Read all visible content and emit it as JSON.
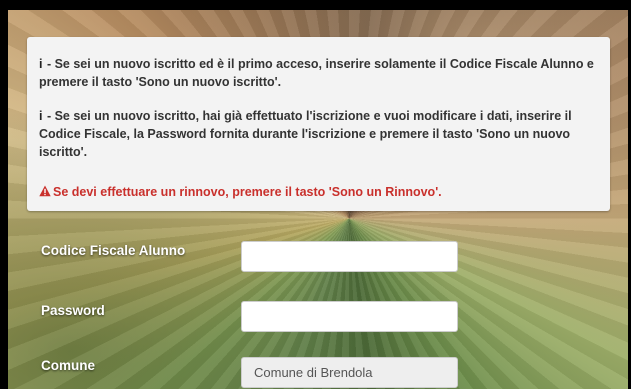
{
  "info": {
    "icon": "i",
    "line1": " - Se sei un nuovo iscritto ed è il primo acceso, inserire solamente il Codice Fiscale Alunno e premere il tasto 'Sono un nuovo iscritto'.",
    "line2": " - Se sei un nuovo iscritto, hai già effettuato l'iscrizione e vuoi modificare i dati, inserire il Codice Fiscale, la Password fornita durante l'iscrizione e premere il tasto 'Sono un nuovo iscritto'.",
    "warning": "Se devi effettuare un rinnovo, premere il tasto 'Sono un Rinnovo'.",
    "warning_icon": "warning-triangle-icon",
    "warning_color": "#c9302c"
  },
  "form": {
    "codice_fiscale_label": "Codice Fiscale Alunno",
    "codice_fiscale_value": "",
    "password_label": "Password",
    "password_value": "",
    "comune_label": "Comune",
    "comune_value": "Comune di Brendola"
  }
}
